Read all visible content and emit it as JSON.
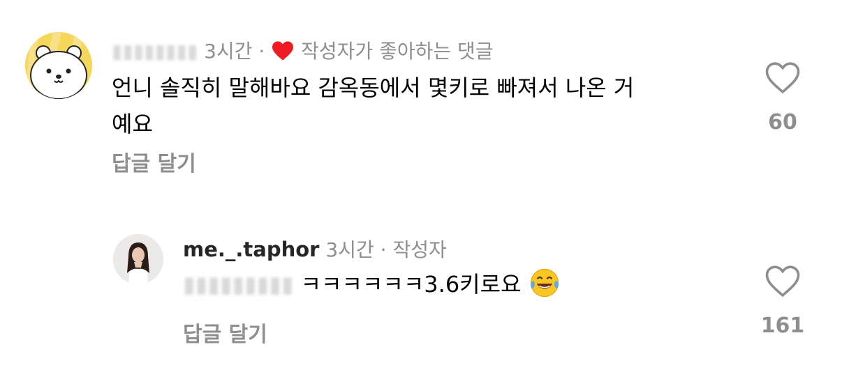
{
  "comments": [
    {
      "meta": {
        "time": "3시간",
        "separator": "·",
        "author_liked": "작성자가 좋아하는 댓글"
      },
      "text_line1": "언니 솔직히 말해바요 감옥동에서 몇키로 빠져서 나온 거",
      "text_line2": "예요",
      "reply_label": "답글 달기",
      "like_count": "60"
    },
    {
      "meta": {
        "username": "me._.taphor",
        "time": "3시간",
        "separator": "·",
        "author_badge": "작성자"
      },
      "text": "ㅋㅋㅋㅋㅋㅋ3.6키로요",
      "reply_label": "답글 달기",
      "like_count": "161"
    }
  ],
  "colors": {
    "liked_heart": "#ed1c24",
    "muted_text": "#8e8e8e",
    "avatar_yellow": "#f5d75c"
  }
}
